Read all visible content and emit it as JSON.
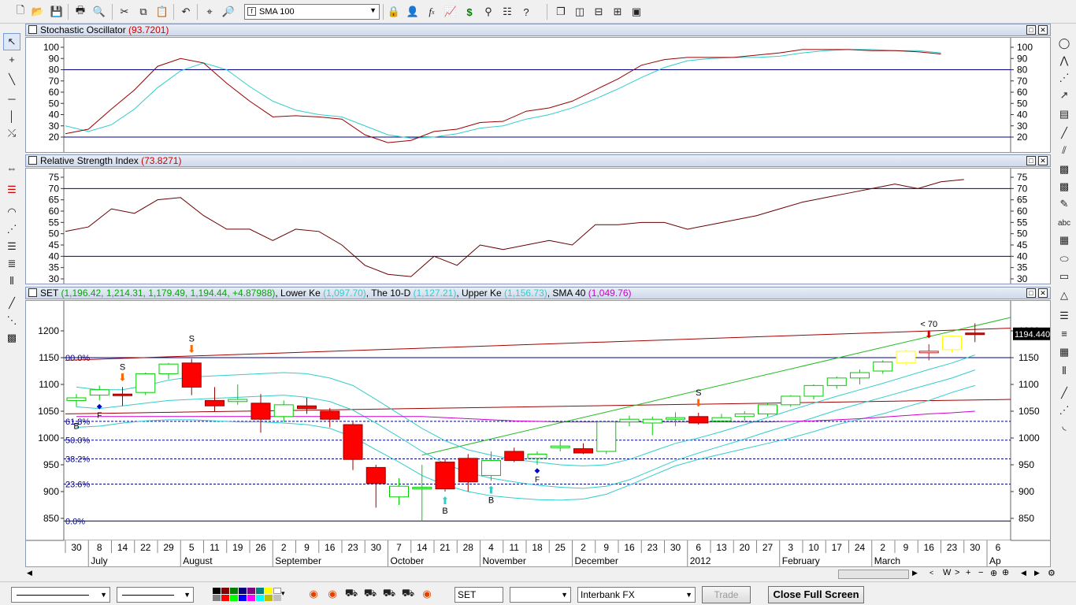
{
  "toolbar": {
    "indicator_select": "SMA 100",
    "icons": [
      "new-icon",
      "open-icon",
      "save-icon",
      "print-icon",
      "print-preview-icon",
      "cut-icon",
      "copy-icon",
      "paste-icon",
      "undo-icon",
      "crosshair-icon",
      "zoom-icon",
      "lock-icon",
      "user-icon",
      "function-icon",
      "chart-icon",
      "dollar-icon",
      "binoculars-icon",
      "properties-icon",
      "help-icon",
      "cascade-icon",
      "tile-vertical-icon",
      "tile-horizontal-icon",
      "tile-icon",
      "screenshot-icon"
    ]
  },
  "stochastic": {
    "title": "Stochastic Oscillator",
    "value": "(93.7201)",
    "value_color": "#cc0000",
    "y_ticks": [
      "100",
      "90",
      "80",
      "70",
      "60",
      "50",
      "40",
      "30",
      "20"
    ],
    "upper_level": 80,
    "lower_level": 20,
    "k_line": [
      23,
      27,
      45,
      62,
      83,
      90,
      86,
      68,
      52,
      38,
      39,
      38,
      36,
      22,
      15,
      17,
      25,
      27,
      33,
      34,
      43,
      46,
      52,
      62,
      72,
      84,
      89,
      91,
      91,
      91,
      93,
      95,
      98,
      98,
      98,
      97,
      97,
      96,
      94
    ],
    "d_line": [
      30,
      25,
      31,
      45,
      64,
      79,
      86,
      80,
      65,
      52,
      44,
      40,
      38,
      30,
      22,
      19,
      20,
      23,
      28,
      30,
      36,
      40,
      46,
      54,
      63,
      73,
      82,
      88,
      90,
      91,
      91,
      92,
      95,
      97,
      98,
      98,
      97,
      97,
      95
    ],
    "k_color": "#990000",
    "d_color": "#33cccc"
  },
  "rsi": {
    "title": "Relative Strength Index",
    "value": "(73.8271)",
    "value_color": "#cc0000",
    "y_ticks": [
      "75",
      "70",
      "65",
      "60",
      "55",
      "50",
      "45",
      "40",
      "35",
      "30"
    ],
    "upper_level": 70,
    "lower_level": 40,
    "line": [
      51,
      53,
      61,
      59,
      65,
      66,
      58,
      52,
      52,
      47,
      52,
      51,
      45,
      36,
      32,
      31,
      40,
      36,
      45,
      43,
      45,
      47,
      45,
      54,
      54,
      55,
      55,
      52,
      54,
      56,
      58,
      61,
      64,
      66,
      68,
      70,
      72,
      70,
      73,
      74
    ],
    "color": "#660000"
  },
  "price": {
    "title": "SET",
    "ohlc_value": "(1,196.42, 1,214.31, 1,179.49, 1,194.44, +4.87988)",
    "lower_label": "Lower Ke",
    "lower_value": "(1,097.70)",
    "mid_label": "The 10-D",
    "mid_value": "(1,127.21)",
    "upper_label": "Upper Ke",
    "upper_value": "(1,156.73)",
    "sma_label": "SMA 40",
    "sma_value": "(1,049.76)",
    "ohlc_color": "#00aa00",
    "keltner_color": "#33cccc",
    "sma_color": "#cc00cc",
    "y_ticks": [
      "1200",
      "1150",
      "1100",
      "1050",
      "1000",
      "950",
      "900",
      "850"
    ],
    "last_price": "1194.440",
    "fib_labels": [
      "00.0%",
      "61.8%",
      "50.0%",
      "38.2%",
      "23.6%",
      "0.0%"
    ],
    "fib_levels": [
      1150,
      1031,
      996,
      961,
      914,
      845
    ],
    "signals": [
      {
        "label": "S",
        "week": 2
      },
      {
        "label": "S",
        "week": 5
      },
      {
        "label": "S",
        "week": 27
      },
      {
        "label": "< 70",
        "week": 37
      },
      {
        "label": "B",
        "week": 0
      },
      {
        "label": "B",
        "week": 16
      },
      {
        "label": "B",
        "week": 18
      },
      {
        "label": "F",
        "week": 1
      },
      {
        "label": "F",
        "week": 20
      }
    ],
    "candles": [
      [
        1070,
        1082,
        1058,
        1075
      ],
      [
        1080,
        1098,
        1070,
        1090
      ],
      [
        1082,
        1095,
        1060,
        1080
      ],
      [
        1085,
        1122,
        1080,
        1120
      ],
      [
        1120,
        1140,
        1110,
        1138
      ],
      [
        1140,
        1148,
        1080,
        1095
      ],
      [
        1070,
        1095,
        1050,
        1060
      ],
      [
        1068,
        1100,
        1062,
        1072
      ],
      [
        1065,
        1082,
        1010,
        1035
      ],
      [
        1040,
        1070,
        1030,
        1062
      ],
      [
        1060,
        1075,
        1045,
        1055
      ],
      [
        1050,
        1056,
        1020,
        1035
      ],
      [
        1025,
        1030,
        940,
        960
      ],
      [
        945,
        950,
        870,
        915
      ],
      [
        890,
        925,
        875,
        910
      ],
      [
        905,
        950,
        845,
        908
      ],
      [
        955,
        962,
        900,
        905
      ],
      [
        962,
        970,
        900,
        918
      ],
      [
        930,
        975,
        920,
        958
      ],
      [
        975,
        982,
        955,
        958
      ],
      [
        962,
        975,
        950,
        970
      ],
      [
        985,
        995,
        975,
        985
      ],
      [
        980,
        990,
        970,
        972
      ],
      [
        975,
        1030,
        970,
        1030
      ],
      [
        1030,
        1042,
        1022,
        1035
      ],
      [
        1028,
        1040,
        1005,
        1035
      ],
      [
        1035,
        1048,
        1022,
        1038
      ],
      [
        1040,
        1047,
        1025,
        1028
      ],
      [
        1032,
        1045,
        1030,
        1038
      ],
      [
        1040,
        1050,
        1032,
        1045
      ],
      [
        1045,
        1065,
        1040,
        1062
      ],
      [
        1062,
        1080,
        1058,
        1078
      ],
      [
        1078,
        1100,
        1072,
        1098
      ],
      [
        1098,
        1115,
        1092,
        1112
      ],
      [
        1112,
        1128,
        1100,
        1122
      ],
      [
        1125,
        1145,
        1120,
        1142
      ],
      [
        1140,
        1165,
        1135,
        1162
      ],
      [
        1162,
        1175,
        1145,
        1162
      ],
      [
        1165,
        1192,
        1160,
        1190
      ],
      [
        1196,
        1214,
        1179,
        1194
      ]
    ],
    "up_color": "#00cc00",
    "down_color": "#ff0000",
    "recent_color": "#ffff00",
    "upper_keltner": [
      1095,
      1090,
      1090,
      1098,
      1108,
      1114,
      1116,
      1118,
      1120,
      1122,
      1120,
      1112,
      1098,
      1072,
      1045,
      1018,
      995,
      978,
      968,
      960,
      955,
      950,
      948,
      950,
      960,
      975,
      990,
      1000,
      1012,
      1025,
      1038,
      1052,
      1065,
      1078,
      1090,
      1102,
      1115,
      1128,
      1140,
      1155
    ],
    "mid_keltner": [
      1058,
      1055,
      1060,
      1065,
      1070,
      1072,
      1074,
      1076,
      1078,
      1080,
      1076,
      1068,
      1052,
      1028,
      1002,
      975,
      952,
      935,
      925,
      918,
      912,
      908,
      906,
      910,
      922,
      940,
      958,
      972,
      985,
      998,
      1012,
      1025,
      1038,
      1052,
      1064,
      1076,
      1088,
      1100,
      1112,
      1127
    ],
    "lower_keltner": [
      1020,
      1022,
      1028,
      1032,
      1034,
      1034,
      1032,
      1030,
      1030,
      1028,
      1025,
      1018,
      1002,
      978,
      955,
      930,
      912,
      900,
      892,
      888,
      885,
      884,
      886,
      895,
      912,
      930,
      948,
      960,
      970,
      980,
      990,
      1000,
      1012,
      1025,
      1035,
      1045,
      1058,
      1070,
      1085,
      1098
    ],
    "sma40": [
      1040,
      1040,
      1040,
      1040,
      1040,
      1040,
      1040,
      1040,
      1040,
      1040,
      1040,
      1040,
      1040,
      1040,
      1040,
      1040,
      1038,
      1036,
      1034,
      1032,
      1031,
      1030,
      1030,
      1030,
      1030,
      1030,
      1030,
      1030,
      1030,
      1030,
      1030,
      1031,
      1032,
      1034,
      1036,
      1039,
      1042,
      1045,
      1047,
      1050
    ],
    "channel_upper": [
      [
        0,
        1145
      ],
      [
        40,
        1180
      ],
      [
        41,
        1193
      ]
    ],
    "channel_lower": [
      [
        0,
        1045
      ],
      [
        41,
        1072
      ]
    ],
    "trend_line": [
      [
        15,
        968
      ],
      [
        41,
        1225
      ]
    ]
  },
  "x_axis": {
    "day_labels": [
      "30",
      "8",
      "14",
      "22",
      "29",
      "5",
      "11",
      "19",
      "26",
      "2",
      "9",
      "16",
      "23",
      "30",
      "7",
      "14",
      "21",
      "28",
      "4",
      "11",
      "18",
      "25",
      "2",
      "9",
      "16",
      "23",
      "30",
      "6",
      "13",
      "20",
      "27",
      "3",
      "10",
      "17",
      "24",
      "2",
      "9",
      "16",
      "23",
      "30",
      "6"
    ],
    "month_labels": [
      {
        "label": "July",
        "week": 1
      },
      {
        "label": "August",
        "week": 5
      },
      {
        "label": "September",
        "week": 9
      },
      {
        "label": "October",
        "week": 14
      },
      {
        "label": "November",
        "week": 18
      },
      {
        "label": "December",
        "week": 22
      },
      {
        "label": "2012",
        "week": 27
      },
      {
        "label": "February",
        "week": 31
      },
      {
        "label": "March",
        "week": 35
      },
      {
        "label": "Ap",
        "week": 40
      }
    ]
  },
  "bottom": {
    "symbol": "SET",
    "empty_combo": "",
    "feed": "Interbank FX",
    "trade": "Trade",
    "close_full_screen": "Close Full Screen"
  },
  "nav": {
    "labels": [
      "W",
      "+",
      "−",
      "+"
    ]
  }
}
